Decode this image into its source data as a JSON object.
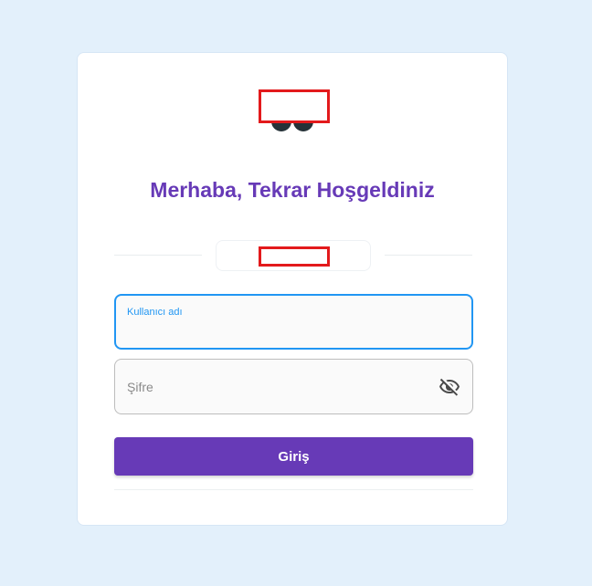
{
  "heading": "Merhaba, Tekrar Hoşgeldiniz",
  "username_field": {
    "label": "Kullanıcı adı",
    "value": ""
  },
  "password_field": {
    "placeholder": "Şifre",
    "value": "",
    "toggle_icon": "eye-off-icon"
  },
  "login_button": {
    "label": "Giriş"
  },
  "colors": {
    "background": "#e3f0fb",
    "accent": "#673ab7",
    "focus": "#2196f3",
    "redaction": "#e31a1c"
  }
}
